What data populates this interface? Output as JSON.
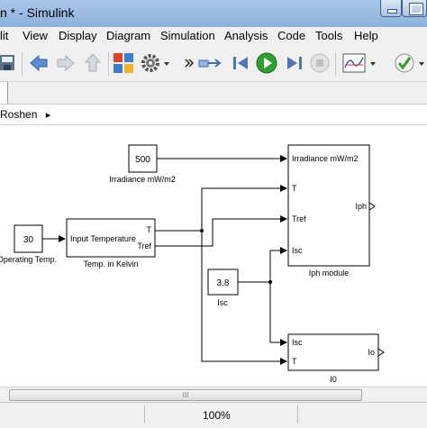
{
  "window": {
    "title": "n * - Simulink"
  },
  "menu": [
    "lit",
    "View",
    "Display",
    "Diagram",
    "Simulation",
    "Analysis",
    "Code",
    "Tools",
    "Help"
  ],
  "breadcrumb": "Roshen",
  "blocks": {
    "irradiance_const": {
      "value": "500",
      "caption": "Irradiance mW/m2"
    },
    "op_temp_const": {
      "value": "30",
      "caption": "Operating Temp."
    },
    "temp_kelvin": {
      "label": "Input Temperature",
      "port_t": "T",
      "port_tref": "Tref",
      "caption": "Temp. in Kelvin"
    },
    "isc_const": {
      "value": "3.8",
      "caption": "Isc"
    },
    "iph_module": {
      "port_irr": "Irradiance mW/m2",
      "port_t": "T",
      "port_tref": "Tref",
      "port_isc": "Isc",
      "port_out": "Iph",
      "caption": "Iph module"
    },
    "i0_block": {
      "port_isc": "Isc",
      "port_t": "T",
      "port_out": "Io",
      "caption": "I0"
    }
  },
  "scroll": {
    "thumb_text": "III"
  },
  "status": {
    "zoom": "100%"
  },
  "icons": [
    "save-icon",
    "back-arrow-icon",
    "forward-arrow-icon",
    "up-arrow-icon",
    "library-browser-icon",
    "settings-gear-icon",
    "more-chevron-icon",
    "link-icon",
    "step-back-icon",
    "run-icon",
    "step-forward-icon",
    "stop-icon",
    "scope-icon",
    "model-advisor-check-icon"
  ]
}
